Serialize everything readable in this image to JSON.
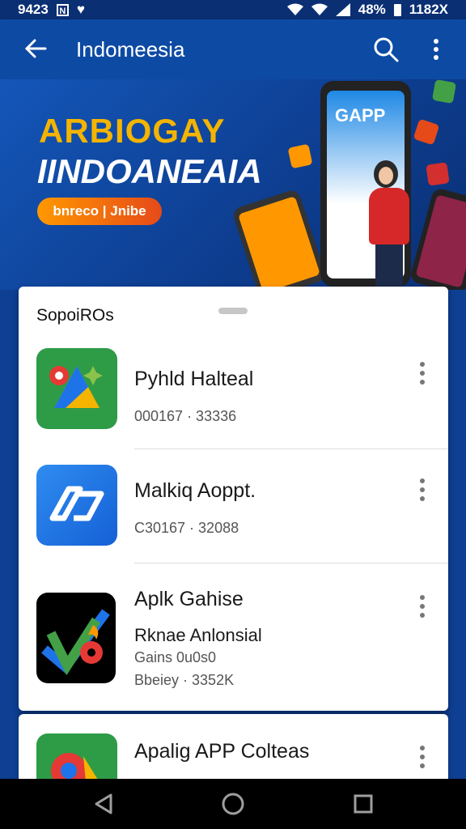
{
  "status_bar": {
    "time": "9423",
    "battery": "48%",
    "clock": "1182X"
  },
  "app_bar": {
    "title": "Indomeesia"
  },
  "banner": {
    "line1": "ARBIOGAY",
    "line2": "IINDOANEAIA",
    "pill": "bnreco | Jnibe",
    "phone_label": "GAPP"
  },
  "list": {
    "title": "SopoiROs",
    "items": [
      {
        "name": "Pyhld Halteal",
        "meta": "000167 · 33336"
      },
      {
        "name": "Malkiq Aoppt.",
        "meta": "C30167 · 32088"
      },
      {
        "name": "Aplk Gahise",
        "subtitle": "Rknae Anlonsial",
        "line3": "Gains 0u0s0",
        "meta": "Bbeiey · 3352K"
      }
    ]
  },
  "next_item": {
    "name": "Apalig APP Colteas"
  },
  "colors": {
    "primary": "#0d4aa4",
    "accent": "#f4b400"
  }
}
